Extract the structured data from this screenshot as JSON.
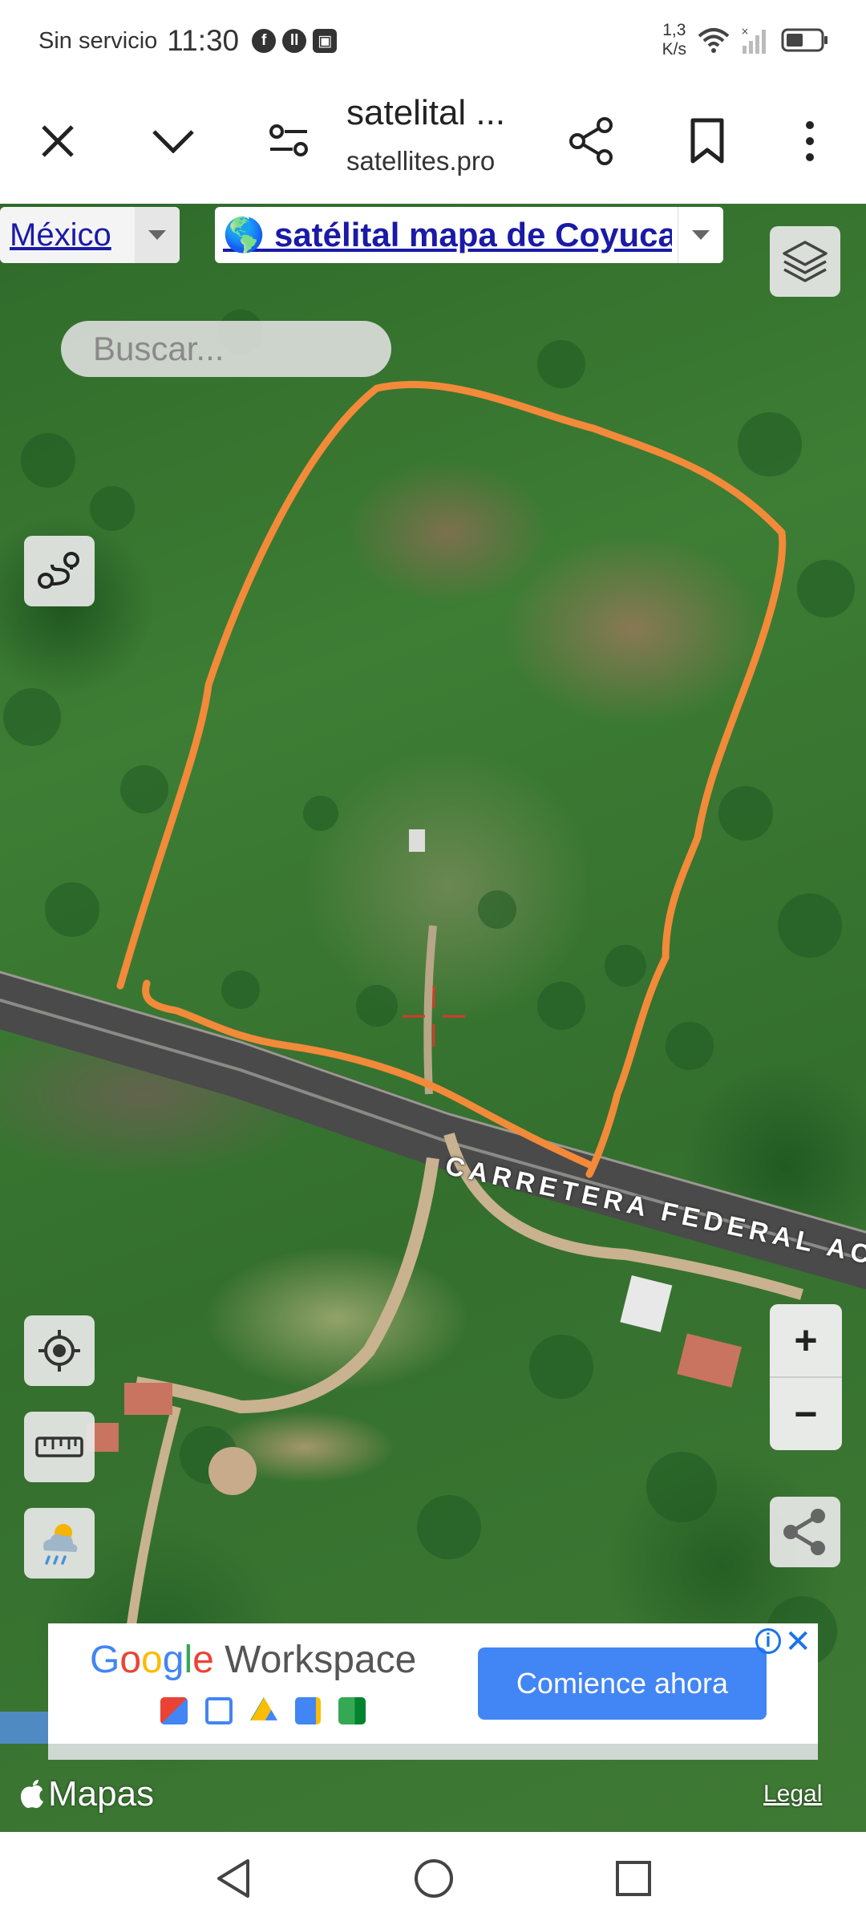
{
  "status_bar": {
    "carrier": "Sin servicio",
    "time": "11:30",
    "speed_value": "1,3",
    "speed_unit": "K/s",
    "icons": [
      "facebook-icon",
      "pause-app-icon",
      "cast-icon",
      "wifi-icon",
      "signal-icon",
      "battery-icon"
    ]
  },
  "browser": {
    "title": "satelital ...",
    "url": "satellites.pro",
    "buttons": [
      "close-icon",
      "chevron-down-icon",
      "page-settings-icon",
      "share-icon",
      "bookmark-icon",
      "more-vert-icon"
    ]
  },
  "map": {
    "country_select": "México",
    "title_select": "🌎 satélital mapa de Coyuca",
    "search_placeholder": "Buscar...",
    "road_label": "CARRETERA FEDERAL ACA",
    "zoom_in": "+",
    "zoom_out": "−",
    "attribution": "Mapas",
    "legal": "Legal",
    "boundary_color": "#f28a3a",
    "crosshair_color": "#d43a2a"
  },
  "ad": {
    "brand_google": "Google",
    "brand_product": "Workspace",
    "cta": "Comience ahora",
    "info": "i",
    "close": "✕",
    "app_icons": [
      "gmail-icon",
      "calendar-icon",
      "drive-icon",
      "docs-icon",
      "meet-icon"
    ]
  },
  "nav": [
    "back-icon",
    "home-icon",
    "recents-icon"
  ]
}
